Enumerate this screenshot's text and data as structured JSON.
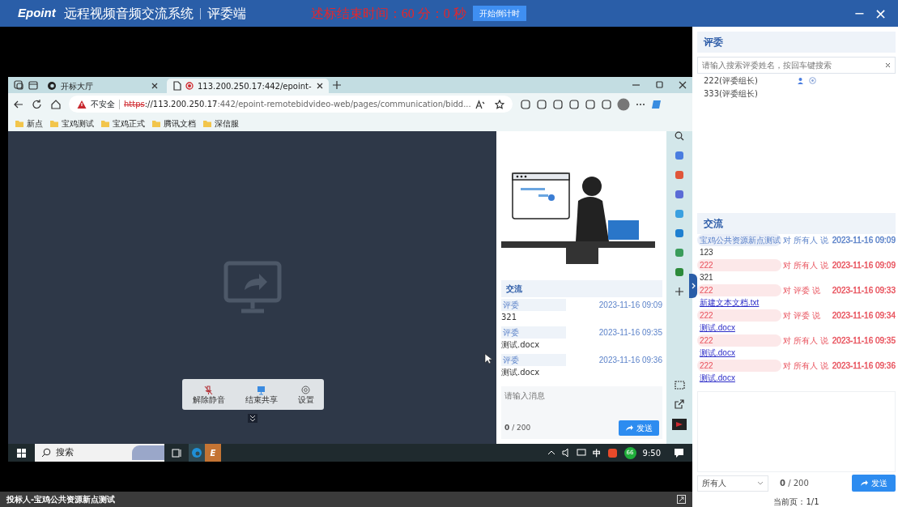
{
  "window": {
    "logo": "Epoint",
    "title": "远程视频音频交流系统",
    "subtitle": "评委端",
    "countdown": "述标结束时间：60 分：0 秒",
    "countdown_button": "开始倒计时",
    "controls": [
      {
        "kind": "minimize",
        "label": "−"
      },
      {
        "kind": "close",
        "label": "×"
      }
    ]
  },
  "shared_screen": {
    "browser": {
      "tabs": [
        {
          "title": "开标大厅",
          "selected": false,
          "kind": "edge"
        },
        {
          "title": "113.200.250.17:442/epoint-",
          "selected": true,
          "kind": "recording"
        }
      ],
      "security_label": "不安全",
      "url_scheme": "https",
      "url_host": "://113.200.250.17",
      "url_path": ":442/epoint-remotebidvideo-web/pages/communication/bidd...",
      "bookmarks": [
        "新点",
        "宝鸡测试",
        "宝鸡正式",
        "腾讯文档",
        "深信服"
      ]
    },
    "meeting_toolbar": [
      {
        "kind": "unmute",
        "label": "解除静音"
      },
      {
        "kind": "stop_share",
        "label": "结束共享"
      },
      {
        "kind": "settings",
        "label": "设置"
      }
    ],
    "chat": {
      "title": "交流",
      "messages": [
        {
          "sender": "评委",
          "time": "2023-11-16 09:09",
          "text": "321"
        },
        {
          "sender": "评委",
          "time": "2023-11-16 09:35",
          "text": "测试.docx"
        },
        {
          "sender": "评委",
          "time": "2023-11-16 09:36",
          "text": "测试.docx"
        }
      ],
      "placeholder": "请输入消息",
      "count": "0",
      "limit": "/ 200",
      "send": "发送"
    },
    "taskbar": {
      "search": "搜索",
      "app_letter": "E",
      "ime": "中",
      "badge": "66",
      "time": "9:50"
    }
  },
  "judges": {
    "title": "评委",
    "search_placeholder": "请输入搜索评委姓名，按回车键搜索",
    "members": [
      {
        "name": "222(评委组长)",
        "status_icons": true
      },
      {
        "name": "333(评委组长)",
        "status_icons": false
      }
    ]
  },
  "chat": {
    "title": "交流",
    "messages": [
      {
        "sender": "宝鸡公共资源新点测试",
        "to": "对 所有人 说",
        "time": "2023-11-16 09:09",
        "text": "123",
        "kind": "text",
        "color": "#5b82c9"
      },
      {
        "sender": "222",
        "to": "对 所有人 说",
        "time": "2023-11-16 09:09",
        "text": "321",
        "kind": "text",
        "color": "#e8505b"
      },
      {
        "sender": "222",
        "to": "对 评委 说",
        "time": "2023-11-16 09:33",
        "text": "新建文本文档.txt",
        "kind": "file",
        "color": "#e8505b"
      },
      {
        "sender": "222",
        "to": "对 评委 说",
        "time": "2023-11-16 09:34",
        "text": "测试.docx",
        "kind": "file",
        "color": "#e8505b"
      },
      {
        "sender": "222",
        "to": "对 所有人 说",
        "time": "2023-11-16 09:35",
        "text": "测试.docx",
        "kind": "file",
        "color": "#e8505b"
      },
      {
        "sender": "222",
        "to": "对 所有人 说",
        "time": "2023-11-16 09:36",
        "text": "测试.docx",
        "kind": "file",
        "color": "#e8505b"
      }
    ],
    "recipient": "所有人",
    "count": "0",
    "limit": "/ 200",
    "send": "发送",
    "pager": "当前页：1/1"
  },
  "footer": {
    "participant": "投标人-宝鸡公共资源新点测试"
  }
}
